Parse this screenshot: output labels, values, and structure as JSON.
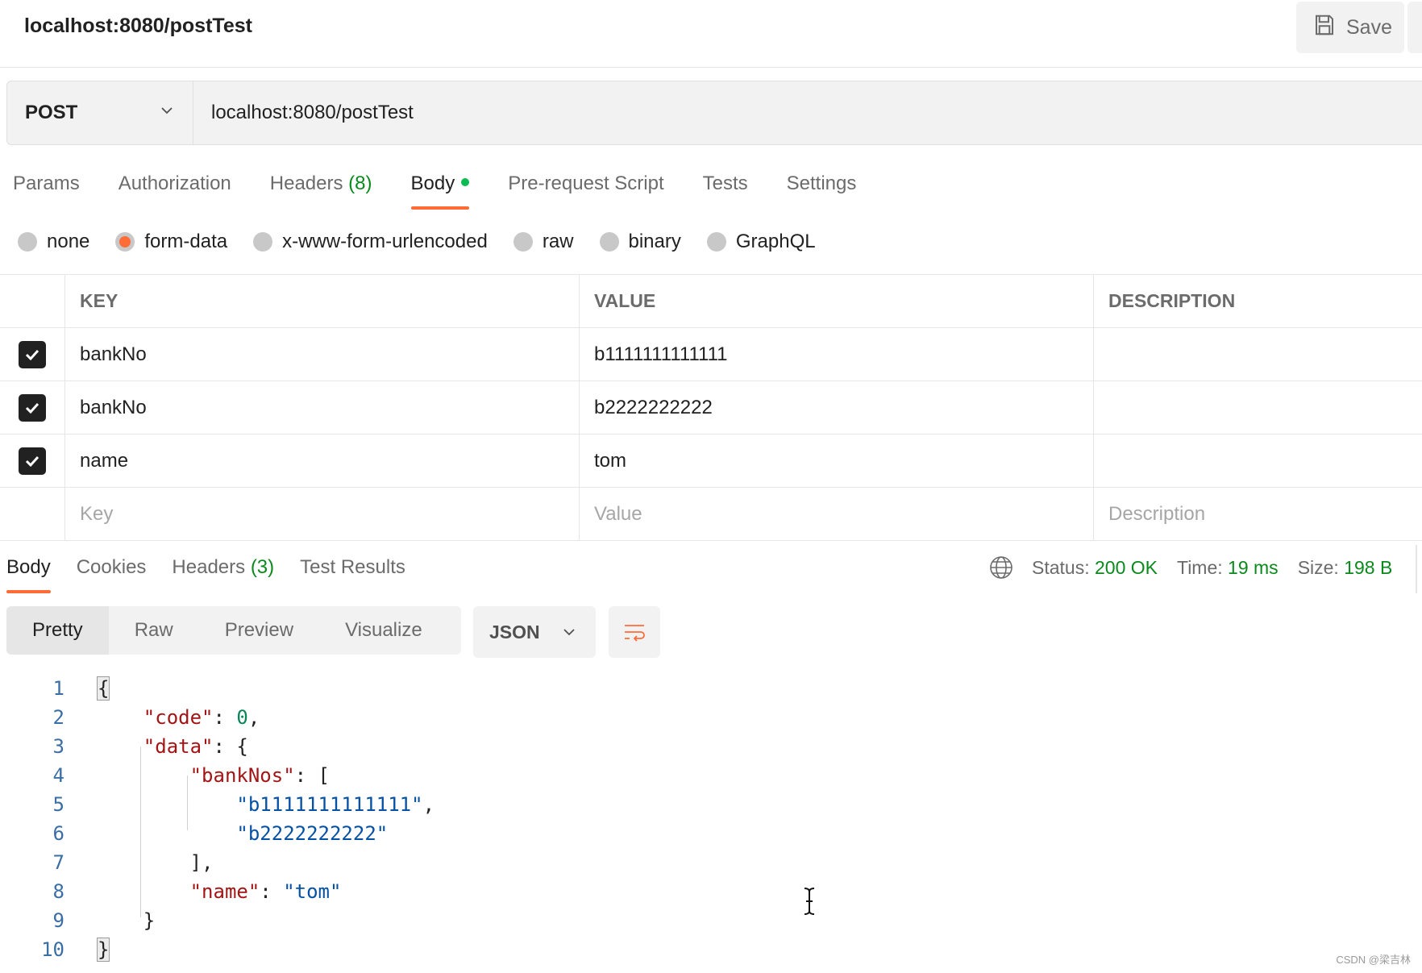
{
  "header": {
    "request_name": "localhost:8080/postTest",
    "save_label": "Save"
  },
  "url_bar": {
    "method": "POST",
    "url": "localhost:8080/postTest"
  },
  "request_tabs": [
    {
      "label": "Params",
      "count": ""
    },
    {
      "label": "Authorization",
      "count": ""
    },
    {
      "label": "Headers",
      "count": "(8)"
    },
    {
      "label": "Body",
      "count": "",
      "active": true
    },
    {
      "label": "Pre-request Script",
      "count": ""
    },
    {
      "label": "Tests",
      "count": ""
    },
    {
      "label": "Settings",
      "count": ""
    }
  ],
  "body_types": [
    {
      "label": "none",
      "checked": false
    },
    {
      "label": "form-data",
      "checked": true
    },
    {
      "label": "x-www-form-urlencoded",
      "checked": false
    },
    {
      "label": "raw",
      "checked": false
    },
    {
      "label": "binary",
      "checked": false
    },
    {
      "label": "GraphQL",
      "checked": false
    }
  ],
  "form_table": {
    "headers": {
      "key": "KEY",
      "value": "VALUE",
      "description": "DESCRIPTION"
    },
    "rows": [
      {
        "checked": true,
        "key": "bankNo",
        "value": "b1111111111111",
        "description": ""
      },
      {
        "checked": true,
        "key": "bankNo",
        "value": "b2222222222",
        "description": ""
      },
      {
        "checked": true,
        "key": "name",
        "value": "tom",
        "description": ""
      }
    ],
    "placeholders": {
      "key": "Key",
      "value": "Value",
      "description": "Description"
    }
  },
  "response_tabs": [
    {
      "label": "Body",
      "count": "",
      "active": true
    },
    {
      "label": "Cookies",
      "count": ""
    },
    {
      "label": "Headers",
      "count": "(3)"
    },
    {
      "label": "Test Results",
      "count": ""
    }
  ],
  "response_meta": {
    "status_label": "Status:",
    "status_value": "200 OK",
    "time_label": "Time:",
    "time_value": "19 ms",
    "size_label": "Size:",
    "size_value": "198 B"
  },
  "view_modes": [
    "Pretty",
    "Raw",
    "Preview",
    "Visualize"
  ],
  "format_select": "JSON",
  "code_lines": [
    "1",
    "2",
    "3",
    "4",
    "5",
    "6",
    "7",
    "8",
    "9",
    "10"
  ],
  "response_json": {
    "open": "{",
    "code_key": "\"code\"",
    "code_val": "0",
    "data_key": "\"data\"",
    "banknos_key": "\"bankNos\"",
    "bank1": "\"b1111111111111\"",
    "bank2": "\"b2222222222\"",
    "name_key": "\"name\"",
    "name_val": "\"tom\"",
    "close": "}"
  },
  "watermark": "CSDN @梁吉林",
  "colors": {
    "accent": "#ff6c37",
    "success": "#0a8a1c",
    "json_key": "#a31515",
    "json_string": "#0451a5",
    "json_number": "#098658"
  }
}
